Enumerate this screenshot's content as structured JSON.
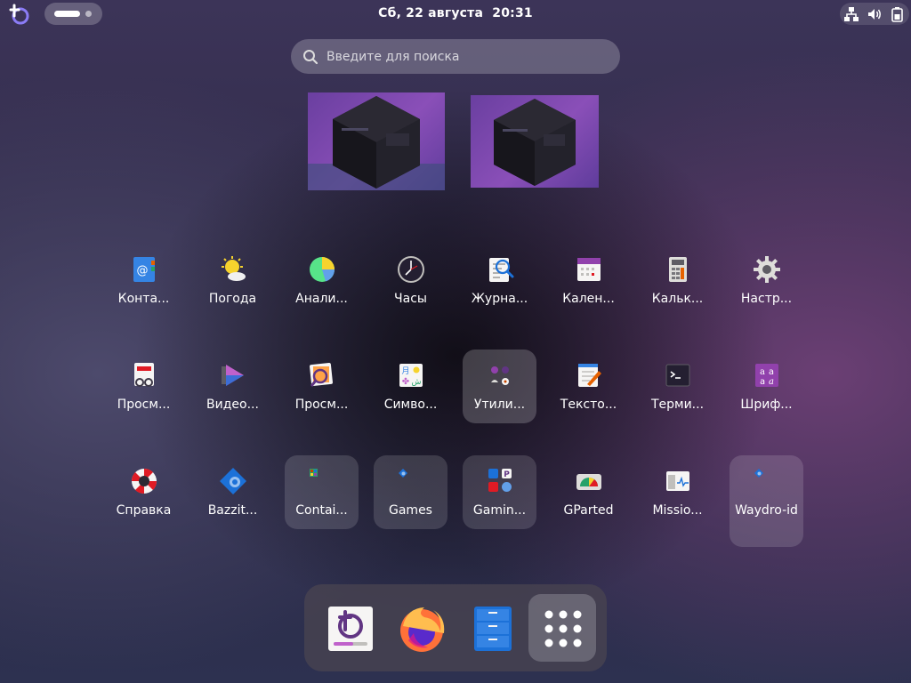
{
  "topbar": {
    "logo_icon": "bazzite-logo-icon",
    "workspace_indicator": {
      "active": 1,
      "count": 2
    },
    "clock": {
      "date": "Сб, 22 августа",
      "time": "20:31"
    },
    "tray_icons": [
      "network-icon",
      "volume-icon",
      "battery-icon"
    ]
  },
  "search": {
    "placeholder": "Введите для поиска",
    "value": ""
  },
  "workspaces": [
    {
      "name": "workspace-1"
    },
    {
      "name": "workspace-2"
    }
  ],
  "app_grid": {
    "rows": [
      [
        {
          "label": "Конта...",
          "icon": "contacts-icon"
        },
        {
          "label": "Погода",
          "icon": "weather-icon"
        },
        {
          "label": "Анали...",
          "icon": "disk-usage-icon"
        },
        {
          "label": "Часы",
          "icon": "clock-icon"
        },
        {
          "label": "Журна...",
          "icon": "logs-icon"
        },
        {
          "label": "Кален...",
          "icon": "calendar-icon"
        },
        {
          "label": "Кальк...",
          "icon": "calculator-icon"
        },
        {
          "label": "Настр...",
          "icon": "settings-gear-icon"
        }
      ],
      [
        {
          "label": "Просм...",
          "icon": "document-viewer-icon"
        },
        {
          "label": "Видео...",
          "icon": "video-player-icon"
        },
        {
          "label": "Просм...",
          "icon": "image-viewer-icon"
        },
        {
          "label": "Симво...",
          "icon": "characters-icon"
        },
        {
          "label": "Утили...",
          "icon": "utilities-folder-icon",
          "folder": true,
          "selected": true
        },
        {
          "label": "Тексто...",
          "icon": "text-editor-icon"
        },
        {
          "label": "Терми...",
          "icon": "terminal-icon"
        },
        {
          "label": "Шриф...",
          "icon": "fonts-icon"
        }
      ],
      [
        {
          "label": "Справка",
          "icon": "help-lifebuoy-icon"
        },
        {
          "label": "Bazzit...",
          "icon": "bazzite-portal-icon"
        },
        {
          "label": "Contai...",
          "icon": "containers-folder-icon",
          "folder": true
        },
        {
          "label": "Games",
          "icon": "games-folder-icon",
          "folder": true
        },
        {
          "label": "Gamin...",
          "icon": "gaming-folder-icon",
          "folder": true
        },
        {
          "label": "GParted",
          "icon": "gparted-icon"
        },
        {
          "label": "Missio...",
          "icon": "mission-center-icon"
        },
        {
          "label": "Waydro-id",
          "icon": "waydroid-folder-icon",
          "folder": true
        }
      ]
    ]
  },
  "dock": {
    "items": [
      {
        "name": "bazzite-portal",
        "icon": "bazzite-portal-icon"
      },
      {
        "name": "firefox",
        "icon": "firefox-icon"
      },
      {
        "name": "files",
        "icon": "files-cabinet-icon"
      },
      {
        "name": "show-apps",
        "icon": "app-grid-icon"
      }
    ]
  },
  "colors": {
    "accent": "#8b3fd6",
    "folder_bg": "rgba(255,255,255,0.14)"
  }
}
